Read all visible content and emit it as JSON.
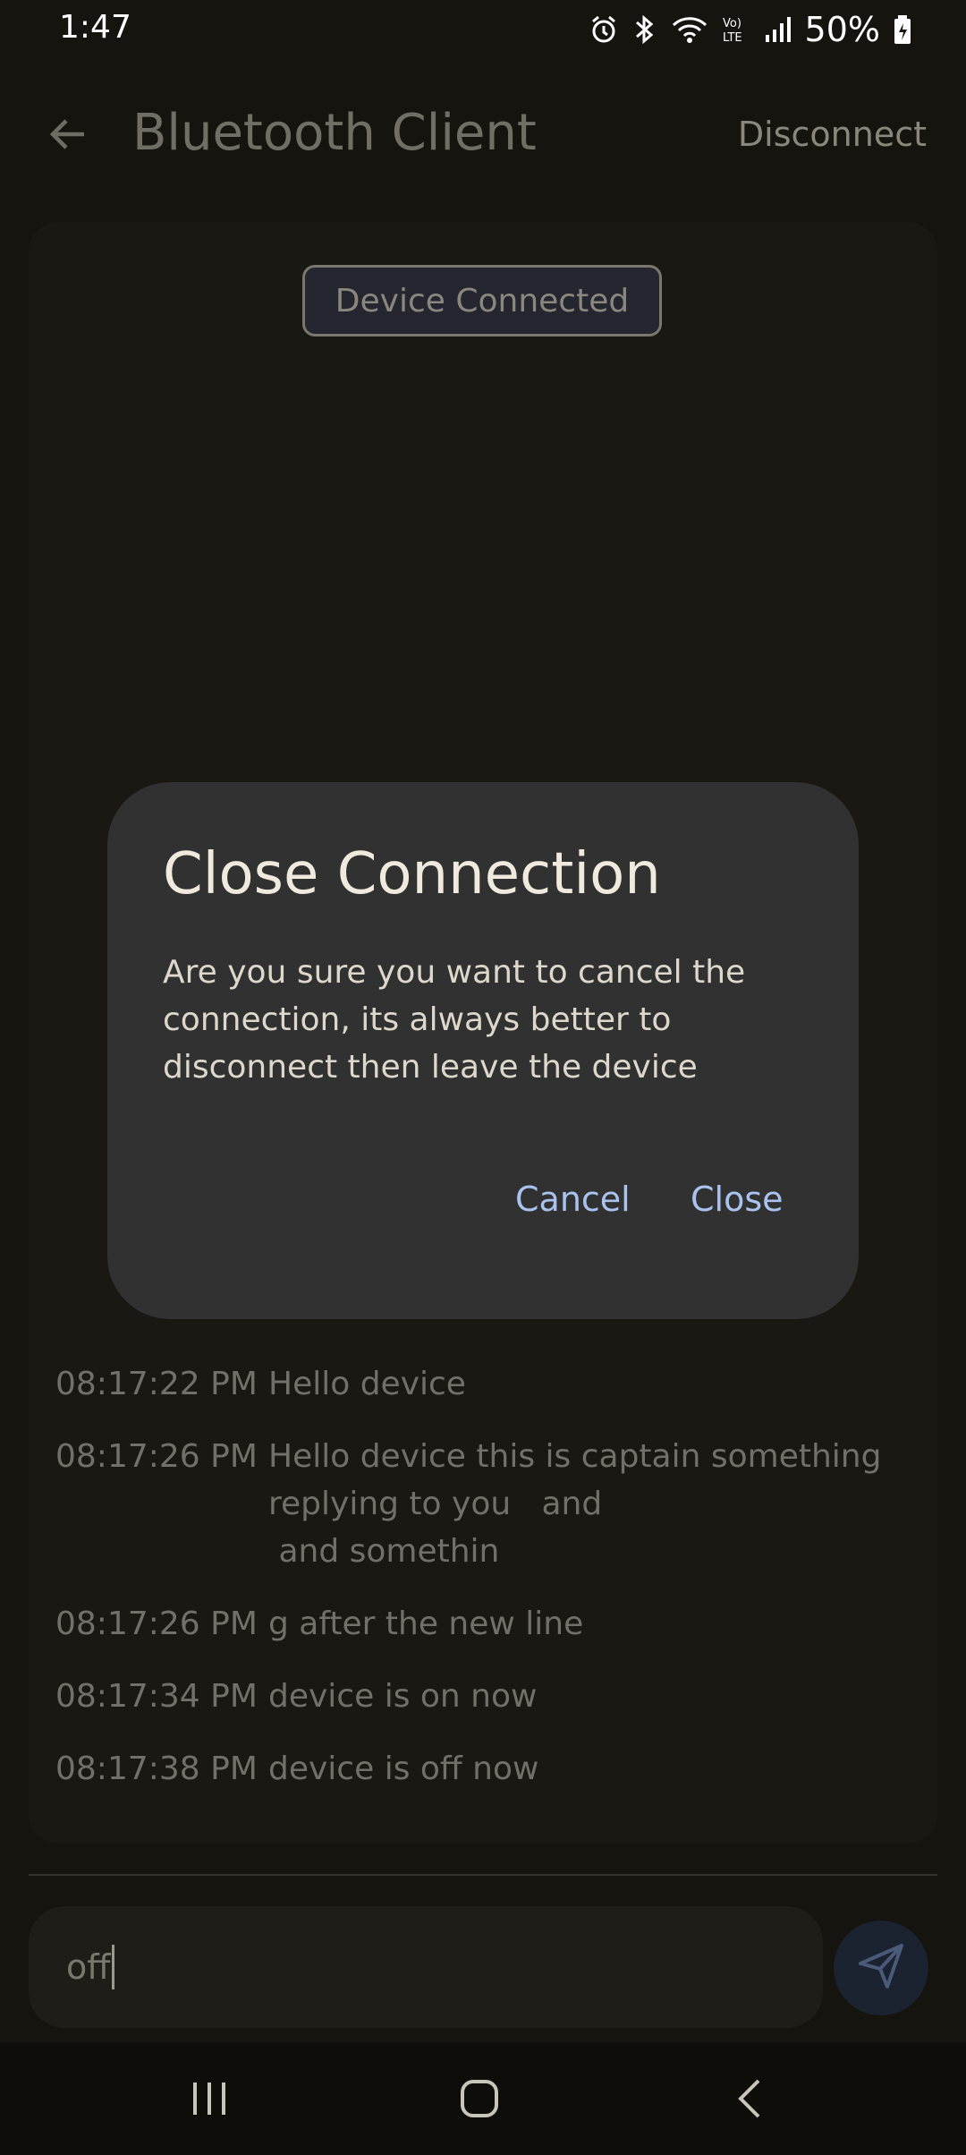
{
  "status_bar": {
    "time": "1:47",
    "battery": "50%"
  },
  "app_bar": {
    "title": "Bluetooth Client",
    "action": "Disconnect"
  },
  "connection_badge": "Device Connected",
  "messages": [
    {
      "time": "08:17:22 PM",
      "text": "Hello device"
    },
    {
      "time": "08:17:26 PM",
      "text": "Hello device this is captain something\nreplying to you   and\n and somethin"
    },
    {
      "time": "08:17:26 PM",
      "text": "g after the new line"
    },
    {
      "time": "08:17:34 PM",
      "text": "device is on now"
    },
    {
      "time": "08:17:38 PM",
      "text": "device is off now"
    }
  ],
  "input": {
    "value": "off"
  },
  "dialog": {
    "title": "Close Connection",
    "body": "Are you sure you want to cancel the connection, its always better to disconnect then leave the device",
    "cancel": "Cancel",
    "confirm": "Close"
  },
  "colors": {
    "accent": "#a9c3ee",
    "dialog_bg": "#313131",
    "background": "#15140f"
  },
  "icons": [
    "alarm-icon",
    "bluetooth-icon",
    "wifi-icon",
    "volte-icon",
    "signal-icon",
    "battery-icon",
    "back-arrow-icon",
    "send-icon",
    "recents-icon",
    "home-icon",
    "nav-back-icon"
  ]
}
